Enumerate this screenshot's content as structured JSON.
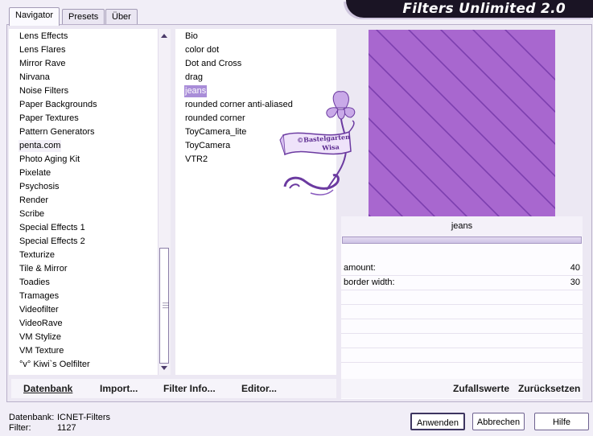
{
  "app": {
    "title": "Filters Unlimited 2.0"
  },
  "tabs": [
    {
      "label": "Navigator"
    },
    {
      "label": "Presets"
    },
    {
      "label": "Über"
    }
  ],
  "categories": [
    "Lens Effects",
    "Lens Flares",
    "Mirror Rave",
    "Nirvana",
    "Noise Filters",
    "Paper Backgrounds",
    "Paper Textures",
    "Pattern Generators",
    "penta.com",
    "Photo Aging Kit",
    "Pixelate",
    "Psychosis",
    "Render",
    "Scribe",
    "Special Effects 1",
    "Special Effects 2",
    "Texturize",
    "Tile & Mirror",
    "Toadies",
    "Tramages",
    "Videofilter",
    "VideoRave",
    "VM Stylize",
    "VM Texture",
    "°v° Kiwi`s Oelfilter"
  ],
  "filters": [
    "Bio",
    "color dot",
    "Dot and Cross",
    "drag",
    "jeans",
    "rounded corner anti-aliased",
    "rounded corner",
    "ToyCamera_lite",
    "ToyCamera",
    "VTR2"
  ],
  "selected_filter": "jeans",
  "watermark": {
    "line1": "©Bastelgarten",
    "line2": "Wisa"
  },
  "params": {
    "filter_name": "jeans",
    "rows": [
      {
        "label": "amount:",
        "value": "40"
      },
      {
        "label": "border width:",
        "value": "30"
      }
    ]
  },
  "actions_left": [
    "Datenbank",
    "Import...",
    "Filter Info...",
    "Editor..."
  ],
  "actions_right": [
    "Zufallswerte",
    "Zurücksetzen"
  ],
  "status": {
    "db_label": "Datenbank:",
    "db_value": "ICNET-Filters",
    "filter_label": "Filter:",
    "filter_value": "1127"
  },
  "buttons": {
    "apply": "Anwenden",
    "cancel": "Abbrechen",
    "help": "Hilfe"
  },
  "colors": {
    "accent": "#a98dd8",
    "preview": "#a867cf",
    "banner": "#1a1424"
  }
}
